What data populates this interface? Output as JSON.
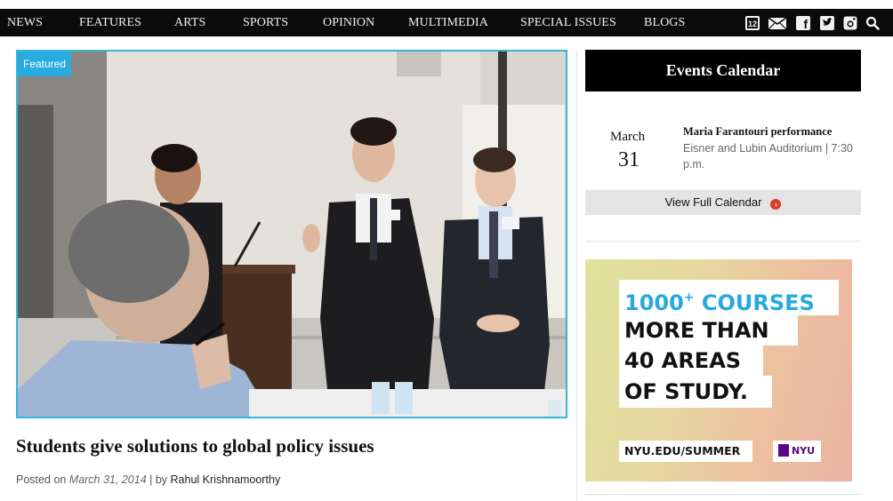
{
  "nav": {
    "items": [
      "NEWS",
      "FEATURES",
      "ARTS",
      "SPORTS",
      "OPINION",
      "MULTIMEDIA",
      "SPECIAL ISSUES",
      "BLOGS"
    ],
    "icons": [
      "calendar-icon",
      "mail-icon",
      "facebook-icon",
      "twitter-icon",
      "instagram-icon",
      "search-icon"
    ],
    "calendar_icon_text": "12"
  },
  "featured": {
    "badge": "Featured",
    "headline": "Students give solutions to global policy issues",
    "byline_prefix": "Posted on",
    "date": "March 31, 2014",
    "byline_sep": "| by",
    "author": "Rahul Krishnamoorthy"
  },
  "events": {
    "heading": "Events Calendar",
    "month": "March",
    "day": "31",
    "title": "Maria Farantouri performance",
    "location": "Eisner and Lubin Auditorium | 7:30 p.m.",
    "view_full": "View Full Calendar"
  },
  "ad": {
    "line1": "1000",
    "line1_sup": "+",
    "line1_rest": " COURSES",
    "line2": "MORE THAN",
    "line3": "40 AREAS",
    "line4": "OF STUDY.",
    "url": "NYU.EDU/SUMMER",
    "logo": "NYU"
  },
  "colors": {
    "nav_bg": "#0b0b0b",
    "accent": "#29abe0",
    "feature_border": "#34b6dd",
    "arrow_red": "#d93a2b",
    "nyu_purple": "#57068c"
  }
}
